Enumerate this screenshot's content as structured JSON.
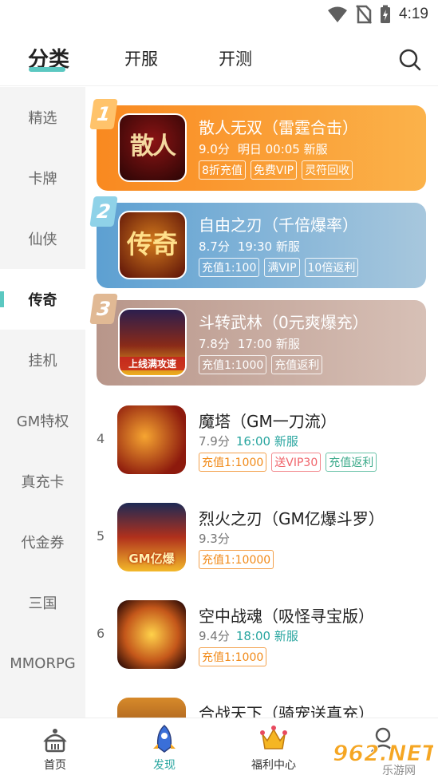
{
  "status_bar": {
    "time": "4:19",
    "icons": [
      "wifi-icon",
      "no-sim-icon",
      "battery-charging-icon"
    ]
  },
  "header": {
    "tabs": [
      {
        "label": "分类",
        "active": true
      },
      {
        "label": "开服",
        "active": false
      },
      {
        "label": "开测",
        "active": false
      }
    ],
    "accent_color": "#5bc8c1"
  },
  "sidebar": {
    "items": [
      {
        "label": "精选"
      },
      {
        "label": "卡牌"
      },
      {
        "label": "仙侠"
      },
      {
        "label": "传奇",
        "active": true
      },
      {
        "label": "挂机"
      },
      {
        "label": "GM特权"
      },
      {
        "label": "真充卡"
      },
      {
        "label": "代金券"
      },
      {
        "label": "三国"
      },
      {
        "label": "MMORPG"
      }
    ]
  },
  "featured": [
    {
      "rank": "1",
      "title": "散人无双（雷霆合击）",
      "score": "9.0分",
      "time": "明日 00:05 新服",
      "tags": [
        "8折充值",
        "免费VIP",
        "灵符回收"
      ],
      "icon_text": "散人"
    },
    {
      "rank": "2",
      "title": "自由之刃（千倍爆率）",
      "score": "8.7分",
      "time": "19:30 新服",
      "tags": [
        "充值1:100",
        "满VIP",
        "10倍返利"
      ],
      "icon_text": "传奇"
    },
    {
      "rank": "3",
      "title": "斗转武林（0元爽爆充）",
      "score": "7.8分",
      "time": "17:00 新服",
      "tags": [
        "充值1:1000",
        "充值返利"
      ],
      "icon_text": "上线满攻速"
    }
  ],
  "list": [
    {
      "rank": "4",
      "title": "魔塔（GM一刀流）",
      "score": "7.9分",
      "time": "16:00 新服",
      "tags": [
        {
          "text": "充值1:1000",
          "style": "orange"
        },
        {
          "text": "送VIP30",
          "style": "red"
        },
        {
          "text": "充值返利",
          "style": "green"
        }
      ]
    },
    {
      "rank": "5",
      "title": "烈火之刃（GM亿爆斗罗）",
      "score": "9.3分",
      "time": "",
      "tags": [
        {
          "text": "充值1:10000",
          "style": "orange"
        }
      ],
      "icon_text": "GM亿爆"
    },
    {
      "rank": "6",
      "title": "空中战魂（吸怪寻宝版）",
      "score": "9.4分",
      "time": "18:00 新服",
      "tags": [
        {
          "text": "充值1:1000",
          "style": "orange"
        }
      ]
    },
    {
      "rank": "",
      "title": "合战天下（骑宠送真充）",
      "score": "",
      "time": "",
      "tags": []
    }
  ],
  "bottom_nav": [
    {
      "label": "首页",
      "icon": "home-icon"
    },
    {
      "label": "发现",
      "icon": "discover-icon",
      "active": true
    },
    {
      "label": "福利中心",
      "icon": "welfare-icon"
    },
    {
      "label": "",
      "icon": "profile-icon"
    }
  ],
  "watermark": {
    "brand": "962.NET",
    "sub": "乐游网"
  }
}
